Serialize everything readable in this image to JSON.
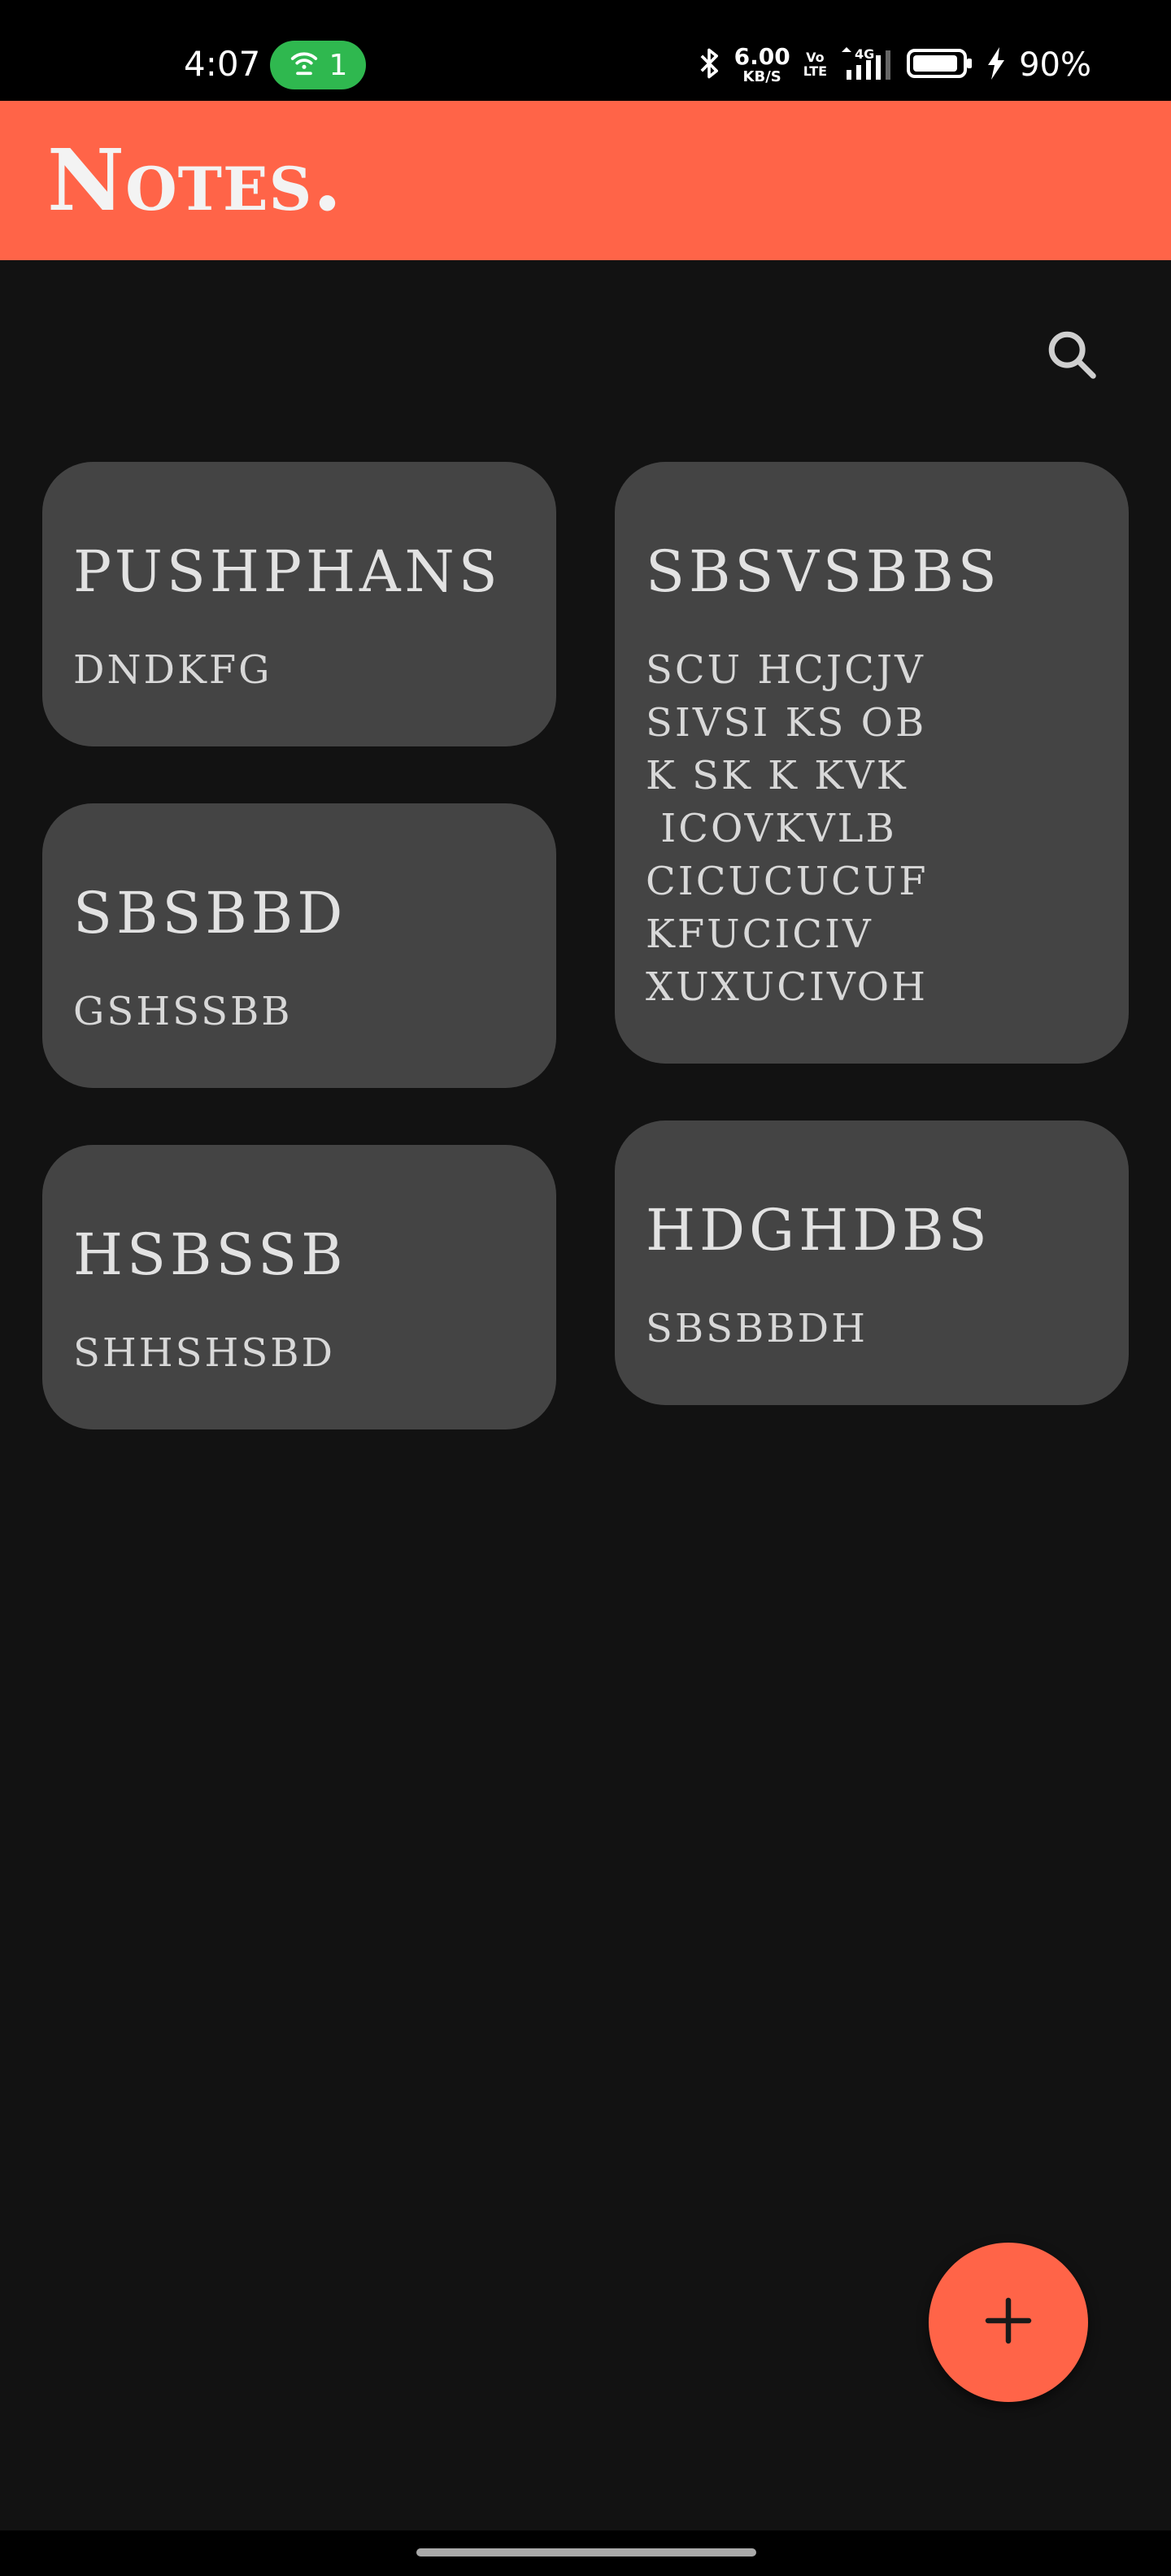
{
  "status_bar": {
    "time": "4:07",
    "hotspot_count": "1",
    "net_speed_value": "6.00",
    "net_speed_unit": "KB/S",
    "volte_top": "Vo",
    "volte_bottom": "LTE",
    "network_type": "4G",
    "battery_percent": "90%",
    "icons": [
      "hotspot-icon",
      "bluetooth-icon",
      "signal-icon",
      "battery-icon",
      "charging-icon"
    ]
  },
  "app_bar": {
    "title": "Notes."
  },
  "search": {
    "icon": "search-icon"
  },
  "notes": [
    {
      "title": "PUSHPHANS",
      "body": "DNDKFG"
    },
    {
      "title": "SBSVSBBS",
      "body": "SCU HCJCJV\nSIVSI KS OB\nK SK K KVK\n ICOVKVLB\nCICUCUCUF\nKFUCICIV\nXUXUCIVOH"
    },
    {
      "title": "SBSBBD",
      "body": "GSHSSBB"
    },
    {
      "title": "HSBSSB",
      "body": "SHHSHSBD"
    },
    {
      "title": "HDGHDBS",
      "body": "SBSBBDH"
    }
  ],
  "fab": {
    "icon": "plus-icon"
  },
  "colors": {
    "accent": "#ff6448",
    "background": "#121212",
    "card": "#444444",
    "text": "#e2e2e2",
    "hotspot": "#2fb84f"
  }
}
